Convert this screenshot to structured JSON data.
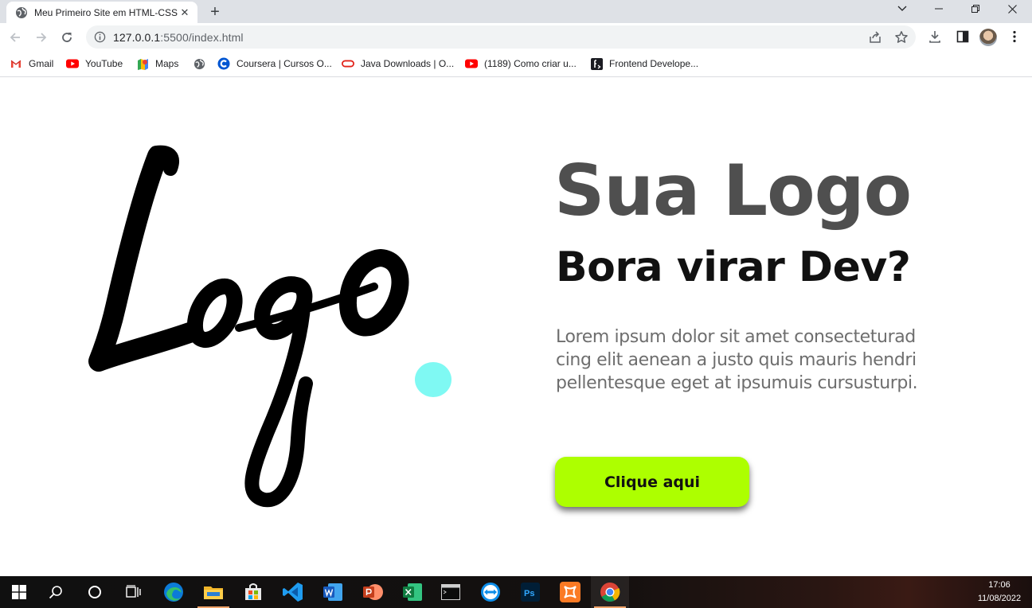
{
  "browser": {
    "tab": {
      "title": "Meu Primeiro Site em HTML-CSS",
      "close_label": "✕"
    },
    "new_tab_label": "+",
    "url": {
      "host": "127.0.0.1",
      "rest": ":5500/index.html"
    }
  },
  "bookmarks": [
    {
      "label": "Gmail",
      "icon": "gmail-icon"
    },
    {
      "label": "YouTube",
      "icon": "youtube-icon"
    },
    {
      "label": "Maps",
      "icon": "maps-icon"
    },
    {
      "label": "",
      "icon": "globe-icon"
    },
    {
      "label": "Coursera | Cursos O...",
      "icon": "coursera-icon"
    },
    {
      "label": "Java Downloads | O...",
      "icon": "oracle-icon"
    },
    {
      "label": "(1189) Como criar u...",
      "icon": "youtube-icon"
    },
    {
      "label": "Frontend Develope...",
      "icon": "frontend-mentor-icon"
    }
  ],
  "hero": {
    "logo_alt": "Logo",
    "title": "Sua Logo",
    "subtitle": "Bora virar Dev?",
    "text": "Lorem ipsum dolor sit amet consecteturad cing elit aenean a justo quis mauris hendri pellentesque eget at ipsumuis cursusturpi.",
    "button_label": "Clique aqui"
  },
  "colors": {
    "accent_button": "#adff00",
    "logo_dot": "#7ff9f3",
    "title": "#4f4f4f"
  },
  "taskbar": {
    "apps": [
      "start-icon",
      "search-icon",
      "cortana-icon",
      "task-view-icon",
      "edge-icon",
      "file-explorer-icon",
      "store-icon",
      "vscode-icon",
      "word-icon",
      "powerpoint-icon",
      "excel-icon",
      "terminal-icon",
      "teamviewer-icon",
      "photoshop-icon",
      "xampp-icon",
      "chrome-icon"
    ],
    "time": "17:06",
    "date": "11/08/2022"
  }
}
